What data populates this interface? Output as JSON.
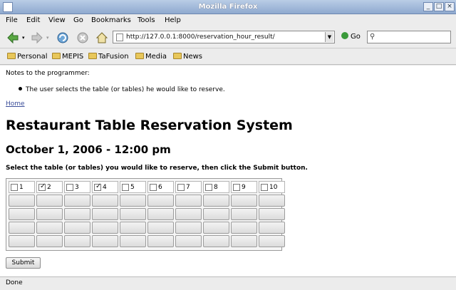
{
  "window": {
    "title": "Mozilla Firefox"
  },
  "menu": [
    "File",
    "Edit",
    "View",
    "Go",
    "Bookmarks",
    "Tools",
    "Help"
  ],
  "nav": {
    "url": "http://127.0.0.1:8000/reservation_hour_result/",
    "go_label": "Go"
  },
  "bookmarks": [
    "Personal",
    "MEPIS",
    "TaFusion",
    "Media",
    "News"
  ],
  "page": {
    "notes_label": "Notes to the programmer:",
    "note_item": "The user selects the table (or tables) he would like to reserve.",
    "home_link": "Home",
    "title": "Restaurant Table Reservation System",
    "date_heading": "October 1, 2006 - 12:00 pm",
    "instructions": "Select the table (or tables) you would like to reserve, then click the Submit button.",
    "tables": [
      {
        "label": "1",
        "checked": false
      },
      {
        "label": "2",
        "checked": true
      },
      {
        "label": "3",
        "checked": false
      },
      {
        "label": "4",
        "checked": true
      },
      {
        "label": "5",
        "checked": false
      },
      {
        "label": "6",
        "checked": false
      },
      {
        "label": "7",
        "checked": false
      },
      {
        "label": "8",
        "checked": false
      },
      {
        "label": "9",
        "checked": false
      },
      {
        "label": "10",
        "checked": false
      }
    ],
    "submit_label": "Submit"
  },
  "status": {
    "text": "Done"
  },
  "colors": {
    "titlebar": "#8fa9cf",
    "link": "#3a4d99",
    "back_arrow": "#3a9a3a"
  }
}
